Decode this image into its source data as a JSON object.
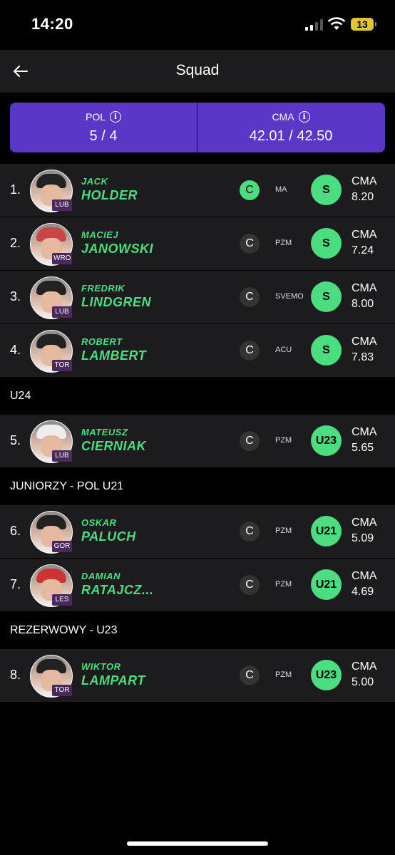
{
  "status_bar": {
    "time": "14:20",
    "battery": "13"
  },
  "nav": {
    "title": "Squad"
  },
  "summary": {
    "left": {
      "label": "POL",
      "value": "5 / 4"
    },
    "right": {
      "label": "CMA",
      "value": "42.01 / 42.50"
    }
  },
  "riders": [
    {
      "rank": "1.",
      "first": "JACK",
      "last": "HOLDER",
      "team": "LUB",
      "captain": "C",
      "captain_active": true,
      "federation": "MA",
      "grade": "S",
      "cma_label": "CMA",
      "cma": "8.20"
    },
    {
      "rank": "2.",
      "first": "MACIEJ",
      "last": "JANOWSKI",
      "team": "WRO",
      "captain": "C",
      "captain_active": false,
      "federation": "PZM",
      "grade": "S",
      "cma_label": "CMA",
      "cma": "7.24"
    },
    {
      "rank": "3.",
      "first": "FREDRIK",
      "last": "LINDGREN",
      "team": "LUB",
      "captain": "C",
      "captain_active": false,
      "federation": "SVEMO",
      "grade": "S",
      "cma_label": "CMA",
      "cma": "8.00"
    },
    {
      "rank": "4.",
      "first": "ROBERT",
      "last": "LAMBERT",
      "team": "TOR",
      "captain": "C",
      "captain_active": false,
      "federation": "ACU",
      "grade": "S",
      "cma_label": "CMA",
      "cma": "7.83"
    },
    {
      "rank": "5.",
      "first": "MATEUSZ",
      "last": "CIERNIAK",
      "team": "LUB",
      "captain": "C",
      "captain_active": false,
      "federation": "PZM",
      "grade": "U23",
      "cma_label": "CMA",
      "cma": "5.65"
    },
    {
      "rank": "6.",
      "first": "OSKAR",
      "last": "PALUCH",
      "team": "GOR",
      "captain": "C",
      "captain_active": false,
      "federation": "PZM",
      "grade": "U21",
      "cma_label": "CMA",
      "cma": "5.09"
    },
    {
      "rank": "7.",
      "first": "DAMIAN",
      "last": "RATAJCZ...",
      "team": "LES",
      "captain": "C",
      "captain_active": false,
      "federation": "PZM",
      "grade": "U21",
      "cma_label": "CMA",
      "cma": "4.69"
    },
    {
      "rank": "8.",
      "first": "WIKTOR",
      "last": "LAMPART",
      "team": "TOR",
      "captain": "C",
      "captain_active": false,
      "federation": "PZM",
      "grade": "U23",
      "cma_label": "CMA",
      "cma": "5.00"
    }
  ],
  "sections": {
    "u24": "U24",
    "juniors": "JUNIORZY - POL U21",
    "reserve": "REZERWOWY - U23"
  },
  "colors": {
    "accent_green": "#4ade80",
    "summary_purple": "#5b37c8",
    "row_bg": "#1c1c1e"
  }
}
